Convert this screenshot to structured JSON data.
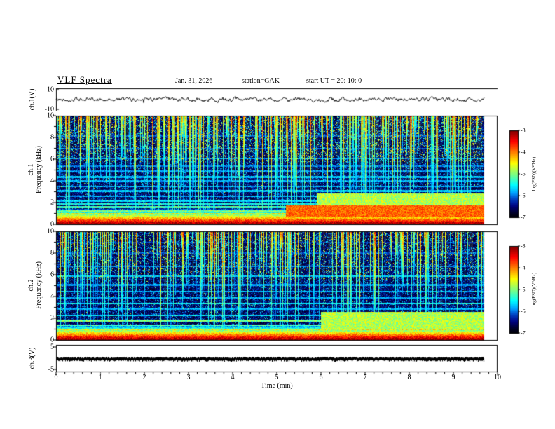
{
  "header": {
    "title": "VLF  Spectra",
    "date": "Jan. 31, 2026",
    "station": "station=GAK",
    "start_ut": "start UT =   20: 10: 0"
  },
  "panels": {
    "ch1_wave": {
      "label": "ch.1(V)",
      "ymax": "10",
      "ymin": "-10"
    },
    "ch1_spec": {
      "channel": "ch.1",
      "ylabel": "Frequency  (kHz)",
      "yticks": [
        "10",
        "8",
        "6",
        "4",
        "2",
        "0"
      ]
    },
    "ch2_spec": {
      "channel": "ch.2",
      "ylabel": "Frequency  (kHz)",
      "yticks": [
        "10",
        "8",
        "6",
        "4",
        "2",
        "0"
      ]
    },
    "ch3_wave": {
      "label": "ch.3(V)",
      "ymax": "5",
      "ymin": "-5"
    }
  },
  "xaxis": {
    "label": "Time  (min)",
    "ticks": [
      "0",
      "1",
      "2",
      "3",
      "4",
      "5",
      "6",
      "7",
      "8",
      "9",
      "10"
    ]
  },
  "colorbar": {
    "label": "log(PSD)(V²/Hz)",
    "ticks": [
      "-3",
      "-4",
      "-5",
      "-6",
      "-7"
    ]
  },
  "chart_data": [
    {
      "type": "line",
      "name": "ch1_waveform",
      "ylabel": "ch.1(V)",
      "ylim": [
        -10,
        10
      ],
      "xlim": [
        0,
        10
      ],
      "xlabel": "Time (min)",
      "data_extent_min": [
        0,
        9.7
      ],
      "description": "Continuous noisy voltage trace centered on 0 V with roughly ±2–3 V fluctuations over 0–9.7 min"
    },
    {
      "type": "heatmap",
      "name": "ch1_spectrogram",
      "ylabel": "Frequency (kHz)",
      "ylim": [
        0,
        10
      ],
      "xlim": [
        0,
        10
      ],
      "data_extent_min": [
        0,
        9.7
      ],
      "colormap": "jet",
      "colorbar_label": "log(PSD)(V²/Hz)",
      "colorbar_range": [
        -7,
        -3
      ],
      "features": [
        "intense red band (PSD near -3) below ~1 kHz across the whole record",
        "dense vertical sferic streaks (green/yellow) descending from 10 kHz, many reaching below 6 kHz",
        "horizontal narrowband lines near 1.0, 1.25, 1.6, 1.9, 2.2, 3.1, 4.4, 6.1 kHz",
        "enhanced green/cyan patch 1.5–2.9 kHz after ~6 min",
        "orange hot band 0.7–1.8 kHz after ~5.2 min",
        "background mostly dark blue/black (PSD near -7 to -6)"
      ]
    },
    {
      "type": "heatmap",
      "name": "ch2_spectrogram",
      "ylabel": "Frequency (kHz)",
      "ylim": [
        0,
        10
      ],
      "xlim": [
        0,
        10
      ],
      "data_extent_min": [
        0,
        9.7
      ],
      "colormap": "jet",
      "colorbar_label": "log(PSD)(V²/Hz)",
      "colorbar_range": [
        -7,
        -3
      ],
      "features": [
        "intense red/orange band (PSD near -3) below ~1 kHz across the whole record",
        "vertical sferic streaks from 10 kHz downward, slightly sparser than ch.1",
        "horizontal narrowband lines near 1.0, 1.4, 1.8, 3.4, 5.9 kHz",
        "broad green/cyan enhancement 1.0–2.6 kHz after ~6 min",
        "background mostly dark blue/black (PSD near -7 to -6)"
      ]
    },
    {
      "type": "line",
      "name": "ch3_waveform",
      "ylabel": "ch.3(V)",
      "ylim": [
        -5,
        5
      ],
      "xlim": [
        0,
        10
      ],
      "data_extent_min": [
        0,
        9.7
      ],
      "description": "Flat dense dark trace at ~0 V for the full 0–9.7 min record"
    }
  ]
}
